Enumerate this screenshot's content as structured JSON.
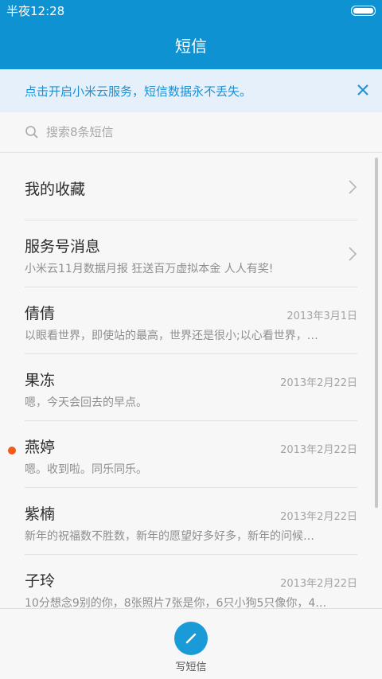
{
  "status_bar": {
    "time": "半夜12:28"
  },
  "header": {
    "title": "短信"
  },
  "banner": {
    "text": "点击开启小米云服务，短信数据永不丢失。"
  },
  "search": {
    "placeholder": "搜索8条短信"
  },
  "conversations": [
    {
      "name": "我的收藏",
      "preview": "",
      "date": "",
      "unread": false,
      "chevron": true
    },
    {
      "name": "服务号消息",
      "preview": "小米云11月数据月报 狂送百万虚拟本金 人人有奖!",
      "date": "",
      "unread": false,
      "chevron": true
    },
    {
      "name": "倩倩",
      "preview": "以眼看世界，即使站的最高，世界还是很小;以心看世界，…",
      "date": "2013年3月1日",
      "unread": false,
      "chevron": false
    },
    {
      "name": "果冻",
      "preview": "嗯，今天会回去的早点。",
      "date": "2013年2月22日",
      "unread": false,
      "chevron": false
    },
    {
      "name": "燕婷",
      "preview": "嗯。收到啦。同乐同乐。",
      "date": "2013年2月22日",
      "unread": true,
      "chevron": false
    },
    {
      "name": "紫楠",
      "preview": "新年的祝福数不胜数，新年的愿望好多好多，新年的问候…",
      "date": "2013年2月22日",
      "unread": false,
      "chevron": false
    },
    {
      "name": "子玲",
      "preview": "10分想念9别的你，8张照片7张是你，6只小狗5只像你，4…",
      "date": "2013年2月22日",
      "unread": false,
      "chevron": false
    }
  ],
  "bottom": {
    "compose_label": "写短信"
  },
  "colors": {
    "primary": "#0f92d1",
    "banner_bg": "#e5f0fa",
    "unread_dot": "#f25a1a"
  },
  "icons": {
    "close": "close-icon",
    "search": "search-icon",
    "chevron": "chevron-right-icon",
    "compose": "pencil-icon"
  }
}
